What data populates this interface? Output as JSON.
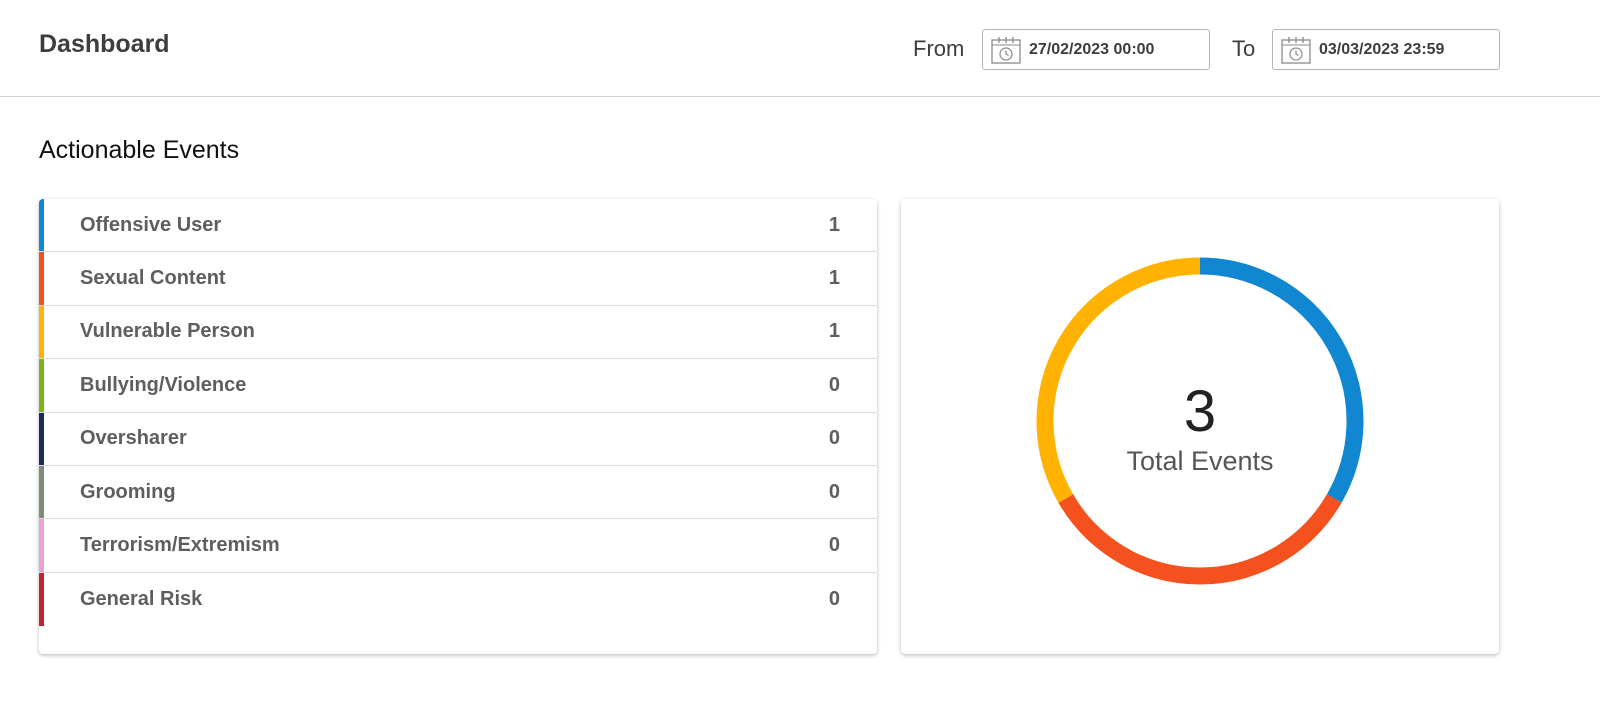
{
  "header": {
    "title": "Dashboard",
    "from_label": "From",
    "from_value": "27/02/2023 00:00",
    "to_label": "To",
    "to_value": "03/03/2023 23:59"
  },
  "section": {
    "title": "Actionable Events"
  },
  "events": [
    {
      "label": "Offensive User",
      "count": "1",
      "color": "#1287d1"
    },
    {
      "label": "Sexual Content",
      "count": "1",
      "color": "#f4511e"
    },
    {
      "label": "Vulnerable Person",
      "count": "1",
      "color": "#ffb300"
    },
    {
      "label": "Bullying/Violence",
      "count": "0",
      "color": "#7cb518"
    },
    {
      "label": "Oversharer",
      "count": "0",
      "color": "#1b2a5a"
    },
    {
      "label": "Grooming",
      "count": "0",
      "color": "#7f8c7a"
    },
    {
      "label": "Terrorism/Extremism",
      "count": "0",
      "color": "#e8a2d1"
    },
    {
      "label": "General Risk",
      "count": "0",
      "color": "#c62032"
    }
  ],
  "chart_data": {
    "type": "pie",
    "categories": [
      "Offensive User",
      "Sexual Content",
      "Vulnerable Person",
      "Bullying/Violence",
      "Oversharer",
      "Grooming",
      "Terrorism/Extremism",
      "General Risk"
    ],
    "values": [
      1,
      1,
      1,
      0,
      0,
      0,
      0,
      0
    ],
    "colors": [
      "#1287d1",
      "#f4511e",
      "#ffb300",
      "#7cb518",
      "#1b2a5a",
      "#7f8c7a",
      "#e8a2d1",
      "#c62032"
    ],
    "center_value": "3",
    "center_label": "Total Events"
  }
}
